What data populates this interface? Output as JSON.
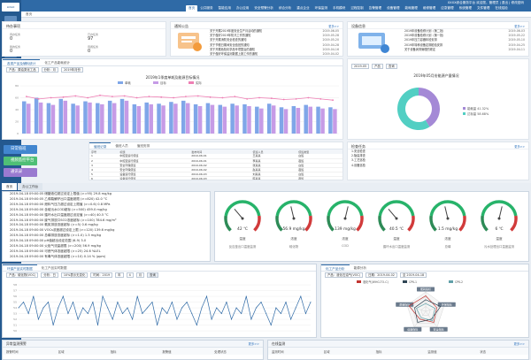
{
  "app": {
    "title": "XXXX综合服务平台",
    "subtitle": "欢迎您，管理员 | 退出 | 修改密码"
  },
  "menu": [
    "首页",
    "公共服务",
    "智能应用",
    "办公应用",
    "安全预警分析",
    "综合分析",
    "重点企业",
    "环保监测",
    "手机模块",
    "过程控制",
    "告警管理",
    "设备管理",
    "能耗管理",
    "维修管理",
    "应急管理",
    "系统管理",
    "文件管理",
    "在线巡检"
  ],
  "crumb": "首页",
  "task": {
    "title": "待办事项",
    "items": [
      {
        "label": "待办任务",
        "value": "0"
      },
      {
        "label": "已办任务",
        "value": "97"
      },
      {
        "label": "我的任务",
        "value": "0"
      },
      {
        "label": "待阅任务",
        "value": "0"
      }
    ]
  },
  "notice": {
    "title": "通知公告",
    "more": "更多>>",
    "items": [
      {
        "t": "关于开展2019年度安全生产月活动的通知",
        "d": "2019-06-05"
      },
      {
        "t": "关于做好2019年防汛工作的通知",
        "d": "2019-05-28"
      },
      {
        "t": "关于开展消防安全检查的通知",
        "d": "2019-05-20"
      },
      {
        "t": "关于节假日期间安全值班的通知",
        "d": "2019-04-28"
      },
      {
        "t": "关于开展危险化学品专项整治的通知",
        "d": "2019-04-16"
      },
      {
        "t": "关于做好环保监测数据上报工作的通知",
        "d": "2019-04-02"
      },
      {
        "t": "关于组织开展应急演练的通知",
        "d": "2019-03-21"
      }
    ]
  },
  "equip": {
    "title": "设备信息",
    "more": "更多>>",
    "items": [
      {
        "t": "2019年设备检修计划（第二批）",
        "d": "2019-06-03"
      },
      {
        "t": "2019年设备检修计划（第一批）",
        "d": "2019-05-22"
      },
      {
        "t": "2019年压力容器年检安排",
        "d": "2019-05-10"
      },
      {
        "t": "2019年特种设备定期检验安排",
        "d": "2019-04-25"
      },
      {
        "t": "关于设备润滑管理的规定",
        "d": "2019-04-11"
      }
    ]
  },
  "prod": {
    "tabs": [
      "各类产品及辅料统计",
      "化工产品能耗统计"
    ],
    "filters": [
      "产品：原油类化工品",
      "分析：月",
      "2019年月份"
    ],
    "chart_title": "2019年1季度单耗及能源目标情况"
  },
  "pie": {
    "filters": [
      "2019-05",
      "产品",
      "查询"
    ],
    "title": "2019年05月份能源产量情况",
    "legend": [
      {
        "name": "能耗量",
        "pct": "41.32%",
        "color": "#a489d6"
      },
      {
        "name": "达标量",
        "pct": "58.68%",
        "color": "#52cfc3"
      }
    ]
  },
  "side": [
    {
      "label": "日常值班",
      "color": "#4286cf"
    },
    {
      "label": "视频监控平台",
      "color": "#4fbf76"
    },
    {
      "label": "通讯录",
      "color": "#9a7ad0"
    }
  ],
  "duty": {
    "title": "最新通知",
    "tabs": [
      "值班记录",
      "值班人员",
      "值班安排"
    ],
    "head": [
      "序号",
      "标题",
      "发布时间",
      "值班人员",
      "值班类型"
    ],
    "rows": [
      [
        "1",
        "中控室运行值班",
        "2019-06-01",
        "王某某",
        "白班"
      ],
      [
        "2",
        "中控室运行值班",
        "2019-06-01",
        "李某某",
        "夜班"
      ],
      [
        "3",
        "安全环保值班",
        "2019-06-02",
        "张某某",
        "白班"
      ],
      [
        "4",
        "安全环保值班",
        "2019-06-02",
        "赵某某",
        "夜班"
      ],
      [
        "5",
        "设备运行值班",
        "2019-06-03",
        "刘某某",
        "白班"
      ],
      [
        "6",
        "设备运行值班",
        "2019-06-03",
        "陈某某",
        "夜班"
      ]
    ]
  },
  "work": {
    "title": "检查任务",
    "more": "更多>>",
    "items": [
      "1.安全检查",
      "2.隐患排查",
      "3.工艺巡检",
      "4.设备巡检"
    ]
  },
  "bottom_tabs": [
    "首页",
    "办公工作台"
  ],
  "logs": [
    "2019-04-18 09:00:05 储罐液位超过设定上限值 (>=95) 29.8 mg/kg",
    "2019-04-18 09:00:05 乙烯裂解炉出口温度超限 (>=820) 42.0 °C",
    "2019-04-18 09:00:00 燃料气压力超过设定上限值 (>=0.6) 0.8 MPa",
    "2019-04-18 09:00:00 含硫污水COD超标 (>=500) 459.0 mg/kg",
    "2019-04-18 09:00:00 循环水出口温度超过设定值 (>=40) 40.5 °C",
    "2019-04-18 09:00:00 废气排放口SO2浓度超标 (>=100) 784.6 mg/m³",
    "2019-04-18 09:00:00 氨氮排放浓度超标 (>=5) 0.6 mg/kg",
    "2019-04-18 09:00:00 VOCs浓度超过设定上限 (>=120) 139.6 mg/kg",
    "2019-04-18 09:00:00 总磷排放浓度超标 (>=1.0) 1.5 mg/kg",
    "2019-04-18 09:00:00 pH值超出设定范围 (6-9) 3.0",
    "2019-04-18 09:00:00 火炬气流量超限 (>=200) 56.9 mg/kg",
    "2019-04-18 09:00:00 可燃气体浓度超限 (>=25) 24.6 %LEL",
    "2019-04-18 09:00:00 有毒气体浓度超限 (>=10) 0.14 % (ppm)"
  ],
  "gauges": [
    {
      "value": "42 ℃",
      "name": "温度",
      "sub": "反应釜出口温度监测"
    },
    {
      "value": "56.9 mg/kg",
      "name": "浓度",
      "sub": "硫化物"
    },
    {
      "value": "139 mg/kg",
      "name": "浓度",
      "sub": "COD"
    },
    {
      "value": "40.5 ℃",
      "name": "温度",
      "sub": "循环水出口温度监测"
    },
    {
      "value": "1.5 mg/kg",
      "name": "浓度",
      "sub": "总磷"
    },
    {
      "value": "6 ℃",
      "name": "温度",
      "sub": "污水处理出口温度监测"
    }
  ],
  "trend": {
    "tabs": [
      "环保产品实时数据",
      "化工产品实时数据"
    ],
    "filters": [
      "产品：硫化物(VOC)",
      "分析：日",
      "10%表示无变化",
      "时间：2019",
      "年",
      "4",
      "月"
    ],
    "more": "查询",
    "yticks": [
      "58",
      "57",
      "56",
      "55",
      "54",
      "53",
      "52",
      "51",
      "50"
    ]
  },
  "radar": {
    "tabs": [
      "化工产品分析",
      "能源分析"
    ],
    "filters": [
      "产品：液化石油气(VOC)",
      "日期：2019-04-02",
      "至 2019-04-18"
    ],
    "legend": [
      {
        "name": "液化气(WHG-TO-C)",
        "color": "#c23531"
      },
      {
        "name": "CPK-1",
        "color": "#2f4554"
      },
      {
        "name": "CPK-2",
        "color": "#61a0a8"
      }
    ],
    "axes": [
      "能耗指标",
      "环保指标",
      "安全指标",
      "设备指标",
      "质量指标"
    ]
  },
  "alarm": {
    "title": "异常监测预警",
    "more": "更多>>",
    "head": [
      "报警时间",
      "区域",
      "指标",
      "报警值",
      "处理状态"
    ]
  },
  "monitor": {
    "title": "在线监测",
    "more": "更多>>",
    "head": [
      "监测时间",
      "区域",
      "指标",
      "监测值",
      "状态"
    ]
  },
  "chart_data": [
    {
      "type": "bar",
      "title": "2019年1季度单耗及能源目标情况",
      "ylabel": "",
      "categories": [
        "1",
        "2",
        "3",
        "4",
        "5",
        "6",
        "7",
        "8",
        "9",
        "10",
        "11",
        "12",
        "13",
        "14",
        "15",
        "16",
        "17",
        "18",
        "19",
        "20",
        "21",
        "22",
        "23",
        "24",
        "25",
        "26"
      ],
      "series": [
        {
          "name": "单耗",
          "color": "#7fa6e8",
          "values": [
            54,
            60,
            51,
            58,
            50,
            54,
            51,
            55,
            58,
            49,
            52,
            50,
            53,
            55,
            49,
            51,
            48,
            50,
            49,
            45,
            50,
            44,
            46,
            48,
            45,
            44
          ]
        },
        {
          "name": "目标",
          "color": "#c69be6",
          "values": [
            50,
            52,
            48,
            55,
            47,
            52,
            49,
            51,
            55,
            46,
            49,
            47,
            50,
            51,
            46,
            48,
            45,
            47,
            46,
            42,
            47,
            41,
            43,
            45,
            42,
            41
          ]
        },
        {
          "name": "实际",
          "color": "#ee7fb4",
          "values": [
            62,
            58,
            60,
            61,
            63,
            60,
            64,
            62,
            63,
            60,
            62,
            61,
            60,
            62,
            63,
            61,
            60,
            62,
            58,
            60,
            59,
            57,
            58,
            60,
            58,
            56
          ]
        }
      ],
      "ylim": [
        0,
        80
      ]
    },
    {
      "type": "pie",
      "title": "2019年05月份能源产量情况",
      "categories": [
        "能耗量",
        "达标量"
      ],
      "values": [
        41.32,
        58.68
      ]
    },
    {
      "type": "line",
      "title": "",
      "categories": [
        "0",
        "1",
        "2",
        "3",
        "4",
        "5",
        "6",
        "7",
        "8",
        "9",
        "10",
        "11",
        "12",
        "13",
        "14",
        "15",
        "16",
        "17",
        "18",
        "19",
        "20",
        "21",
        "22",
        "23",
        "24",
        "25",
        "26",
        "27",
        "28",
        "29",
        "30",
        "31",
        "32",
        "33",
        "34",
        "35",
        "36",
        "37",
        "38",
        "39",
        "40",
        "41",
        "42",
        "43",
        "44",
        "45",
        "46",
        "47",
        "48",
        "49",
        "50",
        "51",
        "52",
        "53",
        "54",
        "55",
        "56",
        "57",
        "58",
        "59"
      ],
      "values": [
        54,
        55,
        53,
        56,
        52,
        54,
        55,
        51,
        54,
        56,
        53,
        55,
        52,
        54,
        53,
        55,
        51,
        56,
        54,
        52,
        55,
        53,
        54,
        52,
        56,
        53,
        54,
        55,
        51,
        54,
        53,
        55,
        52,
        54,
        55,
        53,
        51,
        54,
        56,
        52,
        54,
        53,
        55,
        52,
        54,
        53,
        56,
        52,
        54,
        55,
        53,
        51,
        54,
        53,
        55,
        52,
        54,
        56,
        53,
        55
      ],
      "ylim": [
        50,
        58
      ]
    },
    {
      "type": "radar",
      "categories": [
        "能耗指标",
        "环保指标",
        "安全指标",
        "设备指标",
        "质量指标"
      ],
      "series": [
        {
          "name": "液化气(WHG-TO-C)",
          "values": [
            0.8,
            0.6,
            0.7,
            0.5,
            0.9
          ]
        },
        {
          "name": "CPK-1",
          "values": [
            0.6,
            0.8,
            0.5,
            0.7,
            0.6
          ]
        },
        {
          "name": "CPK-2",
          "values": [
            0.4,
            0.5,
            0.6,
            0.4,
            0.5
          ]
        }
      ]
    }
  ]
}
